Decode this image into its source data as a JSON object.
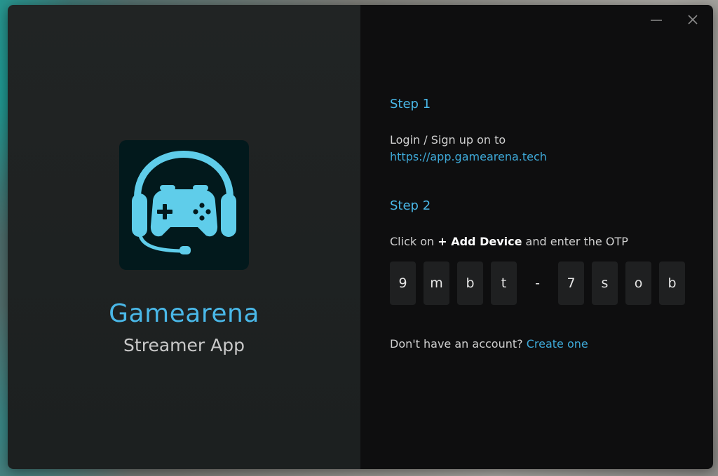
{
  "window": {
    "controls": {
      "minimize_icon": "minus-icon",
      "close_icon": "close-icon"
    }
  },
  "brand": {
    "logo_icon": "gamepad-headset-icon",
    "title": "Gamearena",
    "subtitle": "Streamer App",
    "accent_color": "#4ab8e8"
  },
  "step1": {
    "heading": "Step 1",
    "text": "Login / Sign up on to",
    "link": "https://app.gamearena.tech"
  },
  "step2": {
    "heading": "Step 2",
    "prefix": "Click on",
    "action": "+ Add Device",
    "suffix": "and enter the OTP"
  },
  "otp": [
    "9",
    "m",
    "b",
    "t",
    "-",
    "7",
    "s",
    "o",
    "b"
  ],
  "footer": {
    "question": "Don't have an account?",
    "link": "Create one"
  }
}
